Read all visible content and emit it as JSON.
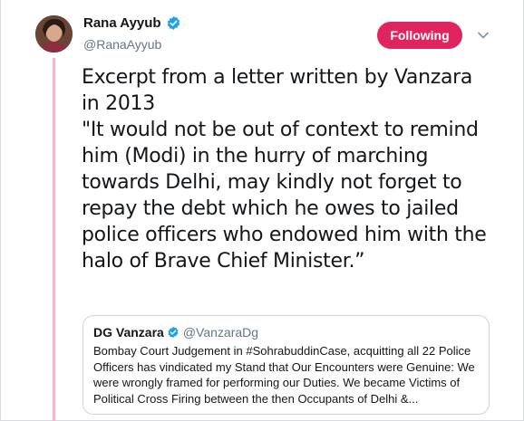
{
  "author": {
    "name": "Rana Ayyub",
    "handle": "@RanaAyyub",
    "verified": true,
    "avatar_icon": "profile-photo"
  },
  "follow_button": {
    "label": "Following",
    "color": "#e0245e"
  },
  "menu": {
    "icon": "chevron-down-icon"
  },
  "tweet": {
    "text": "Excerpt from a letter written by Vanzara in 2013\n\"It would not be out of context to remind him (Modi) in the hurry of marching towards Delhi, may kindly not forget to repay the debt which he owes to jailed police officers who endowed him with the halo of Brave Chief Minister.”"
  },
  "quoted_tweet": {
    "name": "DG Vanzara",
    "handle": "@VanzaraDg",
    "verified": true,
    "text": "Bombay Court Judgement in #SohrabuddinCase, acquitting all 22 Police Officers has vindicated my Stand that Our Encounters were Genuine: We were wrongly framed for performing our Duties. We became Victims of Political Cross Firing between the then Occupants of Delhi &..."
  },
  "colors": {
    "accent": "#e0245e",
    "verified": "#1da1f2",
    "thread_line": "#f7b6cc",
    "secondary_text": "#657786"
  }
}
